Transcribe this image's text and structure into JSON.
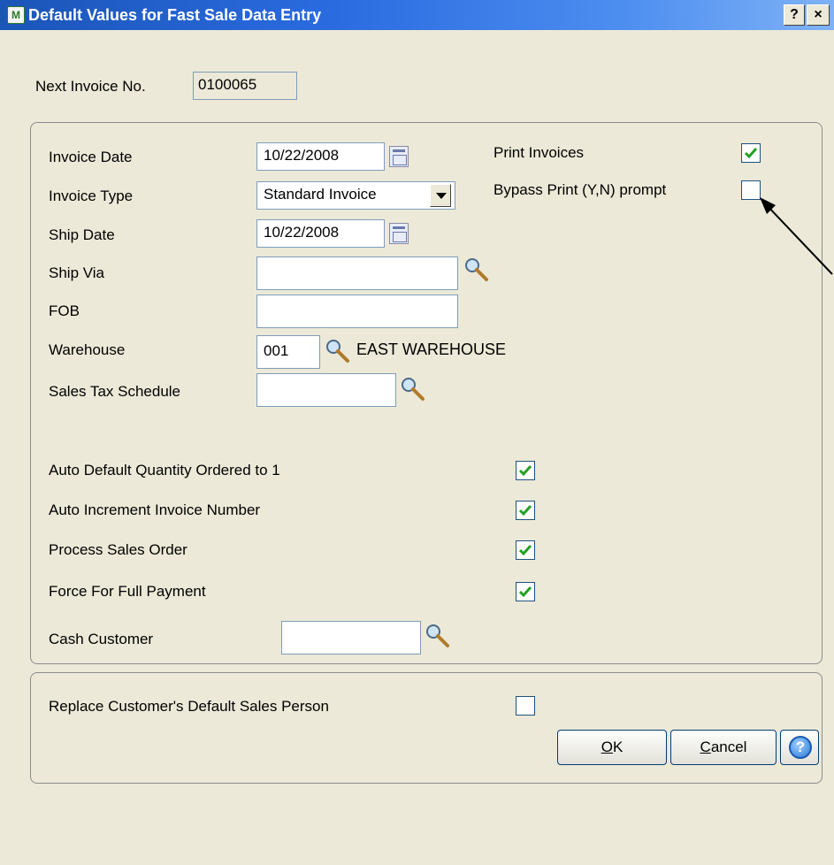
{
  "window": {
    "title": "Default Values for Fast Sale Data Entry",
    "help_glyph": "?",
    "close_glyph": "×",
    "app_icon_text": "M"
  },
  "next_invoice": {
    "label": "Next Invoice No.",
    "value": "0100065"
  },
  "main": {
    "invoice_date": {
      "label": "Invoice Date",
      "value": "10/22/2008"
    },
    "invoice_type": {
      "label": "Invoice Type",
      "value": "Standard Invoice"
    },
    "ship_date": {
      "label": "Ship Date",
      "value": "10/22/2008"
    },
    "ship_via": {
      "label": "Ship Via",
      "value": ""
    },
    "fob": {
      "label": "FOB",
      "value": ""
    },
    "warehouse": {
      "label": "Warehouse",
      "value": "001",
      "description": "EAST WAREHOUSE"
    },
    "sales_tax_schedule": {
      "label": "Sales Tax Schedule",
      "value": ""
    },
    "print_invoices": {
      "label": "Print Invoices",
      "checked": true
    },
    "bypass_print": {
      "label": "Bypass Print (Y,N) prompt",
      "checked": false
    },
    "auto_default_qty": {
      "label": "Auto Default Quantity Ordered to 1",
      "checked": true
    },
    "auto_increment": {
      "label": "Auto Increment Invoice Number",
      "checked": true
    },
    "process_sales_order": {
      "label": "Process Sales Order",
      "checked": true
    },
    "force_full_payment": {
      "label": "Force For Full Payment",
      "checked": true
    },
    "cash_customer": {
      "label": "Cash Customer",
      "value": ""
    }
  },
  "secondary": {
    "replace_sales_person": {
      "label": "Replace Customer's Default Sales Person",
      "checked": false
    }
  },
  "buttons": {
    "ok_mnemonic": "O",
    "ok_rest": "K",
    "cancel_mnemonic": "C",
    "cancel_rest": "ancel",
    "help_glyph": "?"
  },
  "colors": {
    "titlebar": "#2a6be0",
    "dialog_bg": "#ece9d8",
    "check": "#21a121"
  }
}
